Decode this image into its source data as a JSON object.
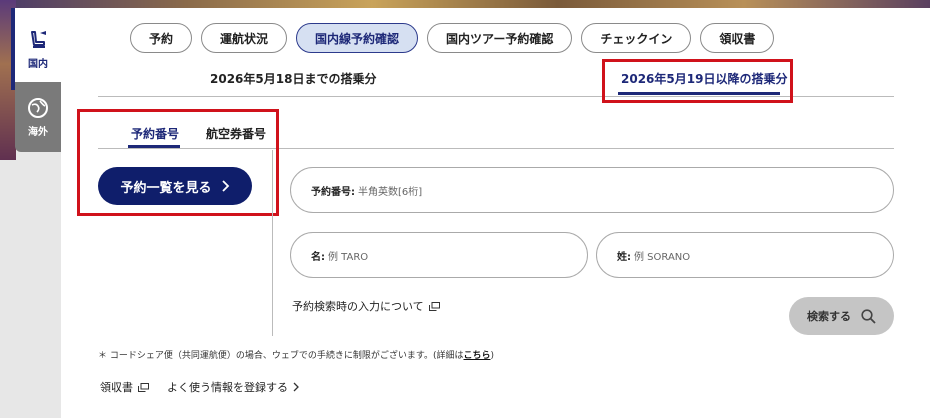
{
  "side_tabs": [
    {
      "label": "国内",
      "icon": "seat-icon",
      "active": true
    },
    {
      "label": "海外",
      "icon": "globe-icon",
      "active": false
    }
  ],
  "pills": [
    "予約",
    "運航状況",
    "国内線予約確認",
    "国内ツアー予約確認",
    "チェックイン",
    "領収書"
  ],
  "active_pill": "国内線予約確認",
  "period_tabs": {
    "before": "2026年5月18日までの搭乗分",
    "after": "2026年5月19日以降の搭乗分"
  },
  "sub_tabs": {
    "reservation_number": "予約番号",
    "ticket_number": "航空券番号"
  },
  "list_button": "予約一覧を見る",
  "fields": {
    "reservation": {
      "label": "予約番号:",
      "placeholder": "半角英数[6桁]"
    },
    "first_name": {
      "label": "名:",
      "placeholder": "例 TARO"
    },
    "last_name": {
      "label": "姓:",
      "placeholder": "例 SORANO"
    }
  },
  "input_help_link": "予約検索時の入力について",
  "search_button": "検索する",
  "footnote": {
    "text": "＊ コードシェア便（共同運航便）の場合、ウェブでの手続きに制限がございます。(詳細は",
    "link": "こちら",
    "close": ")"
  },
  "bottom_links": {
    "receipt": "領収書",
    "register": "よく使う情報を登録する"
  },
  "colors": {
    "navy": "#0f1e6b",
    "highlight_red": "#d0121b",
    "active_pill_bg": "#d6e0f2"
  }
}
